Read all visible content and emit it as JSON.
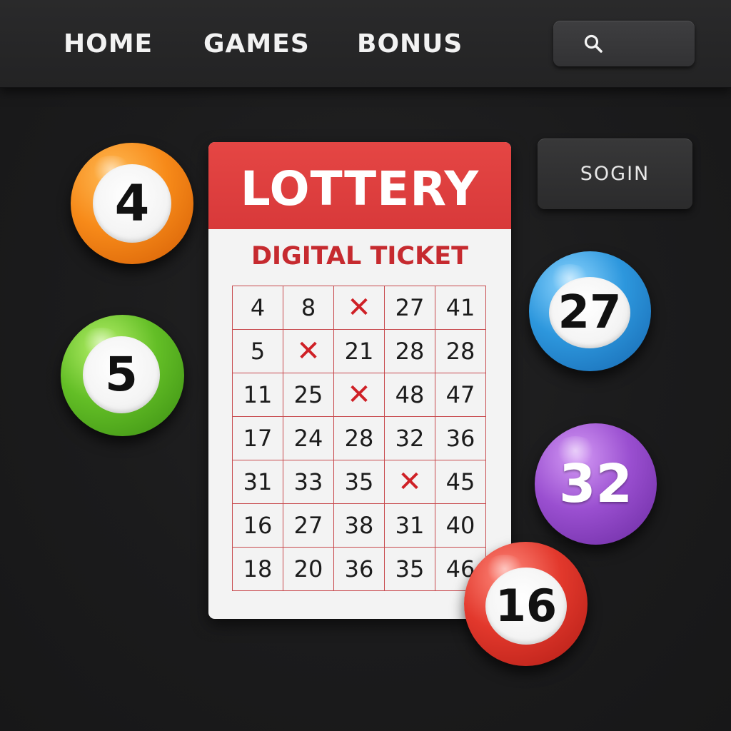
{
  "nav": {
    "links": [
      "HOME",
      "GAMES",
      "BONUS"
    ],
    "search": {
      "icon": "search-icon",
      "placeholder": ""
    }
  },
  "login": {
    "label": "SOGIN"
  },
  "ticket": {
    "title": "LOTTERY",
    "subtitle": "DIGITAL TICKET",
    "mark_symbol": "✕",
    "rows": [
      [
        "4",
        "8",
        "✕",
        "27",
        "41"
      ],
      [
        "5",
        "✕",
        "21",
        "28",
        "28"
      ],
      [
        "11",
        "25",
        "✕",
        "48",
        "47"
      ],
      [
        "17",
        "24",
        "28",
        "32",
        "36"
      ],
      [
        "31",
        "33",
        "35",
        "✕",
        "45"
      ],
      [
        "16",
        "27",
        "38",
        "31",
        "40"
      ],
      [
        "18",
        "20",
        "36",
        "35",
        "46"
      ]
    ]
  },
  "balls": [
    {
      "number": "4",
      "color": "#f78a19"
    },
    {
      "number": "5",
      "color": "#63be26"
    },
    {
      "number": "27",
      "color": "#2d97dd"
    },
    {
      "number": "32",
      "color": "#9a4fd0"
    },
    {
      "number": "16",
      "color": "#e2382c"
    }
  ],
  "colors": {
    "background": "#1b1b1c",
    "ticket_header": "#e54644",
    "ticket_accent": "#c62a2f"
  }
}
